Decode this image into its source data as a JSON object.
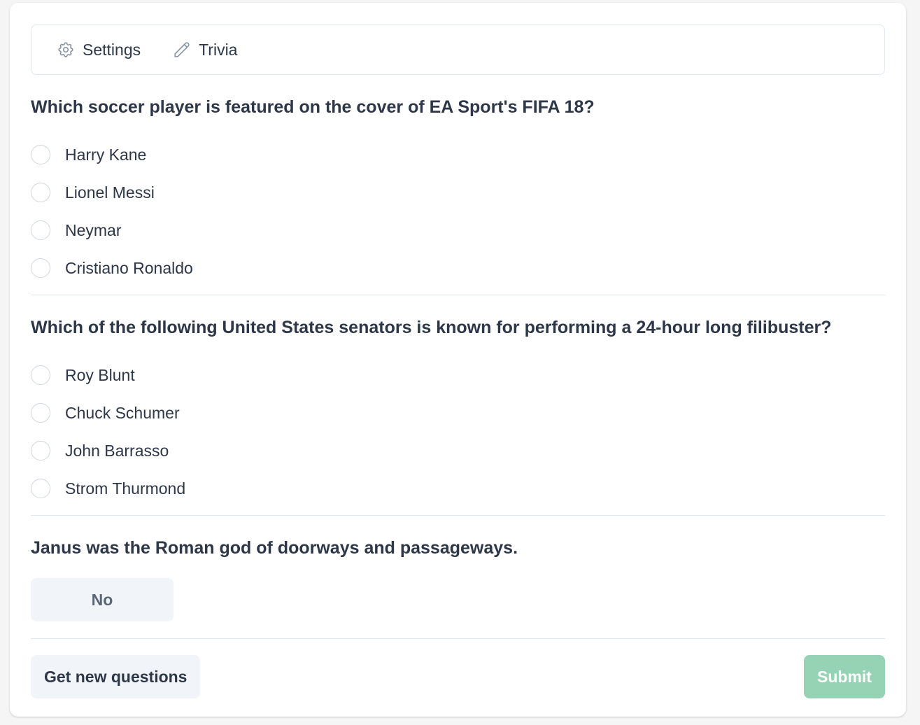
{
  "tabs": [
    {
      "label": "Settings",
      "icon": "gear-icon"
    },
    {
      "label": "Trivia",
      "icon": "pencil-icon"
    }
  ],
  "questions": [
    {
      "title": "Which soccer player is featured on the cover of EA Sport's FIFA 18?",
      "options": [
        "Harry Kane",
        "Lionel Messi",
        "Neymar",
        "Cristiano Ronaldo"
      ]
    },
    {
      "title": "Which of the following United States senators is known for performing a 24-hour long filibuster?",
      "options": [
        "Roy Blunt",
        "Chuck Schumer",
        "John Barrasso",
        "Strom Thurmond"
      ]
    },
    {
      "title": "Janus was the Roman god of doorways and passageways.",
      "answer_button": "No"
    }
  ],
  "footer": {
    "new_questions_label": "Get new questions",
    "submit_label": "Submit"
  },
  "colors": {
    "submit_disabled": "#96d3b4",
    "secondary_button": "#f1f4f8",
    "border": "#e2e8f0"
  }
}
